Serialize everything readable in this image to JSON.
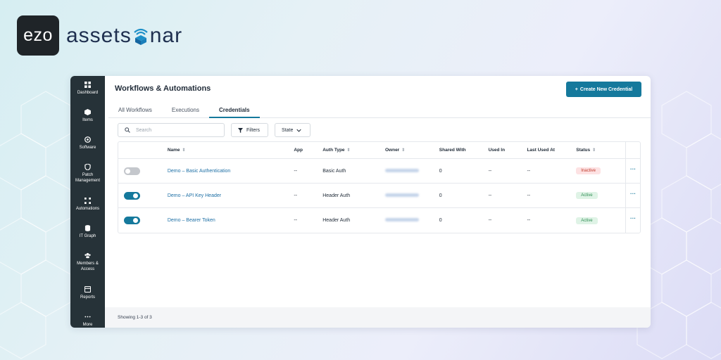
{
  "brand": {
    "logo_text": "ezo",
    "name_prefix": "assets",
    "name_suffix": "nar",
    "accent": "#15799c"
  },
  "sidebar": {
    "items": [
      {
        "label": "Dashboard",
        "icon": "dashboard-icon"
      },
      {
        "label": "Items",
        "icon": "box-icon"
      },
      {
        "label": "Software",
        "icon": "disc-icon"
      },
      {
        "label": "Patch Management",
        "icon": "shield-icon"
      },
      {
        "label": "Automations",
        "icon": "automation-icon"
      },
      {
        "label": "IT Graph",
        "icon": "database-icon"
      },
      {
        "label": "Members & Access",
        "icon": "members-icon"
      },
      {
        "label": "Reports",
        "icon": "report-icon"
      },
      {
        "label": "More",
        "icon": "more-icon"
      }
    ]
  },
  "header": {
    "title": "Workflows & Automations",
    "create_label": "Create New Credential"
  },
  "tabs": [
    {
      "label": "All Workflows",
      "active": false
    },
    {
      "label": "Executions",
      "active": false
    },
    {
      "label": "Credentials",
      "active": true
    }
  ],
  "toolbar": {
    "search_placeholder": "Search",
    "filters_label": "Filters",
    "state_label": "State"
  },
  "table": {
    "columns": [
      "Name",
      "App",
      "Auth Type",
      "Owner",
      "Shared With",
      "Used In",
      "Last Used At",
      "Status"
    ],
    "rows": [
      {
        "enabled": false,
        "name": "Demo – Basic Authentication",
        "app": "--",
        "auth_type": "Basic Auth",
        "shared_with": "0",
        "used_in": "--",
        "last_used_at": "--",
        "status": "Inactive"
      },
      {
        "enabled": true,
        "name": "Demo – API Key Header",
        "app": "--",
        "auth_type": "Header Auth",
        "shared_with": "0",
        "used_in": "--",
        "last_used_at": "--",
        "status": "Active"
      },
      {
        "enabled": true,
        "name": "Demo – Bearer Token",
        "app": "--",
        "auth_type": "Header Auth",
        "shared_with": "0",
        "used_in": "--",
        "last_used_at": "--",
        "status": "Active"
      }
    ]
  },
  "footer": {
    "showing": "Showing 1-3 of 3"
  }
}
